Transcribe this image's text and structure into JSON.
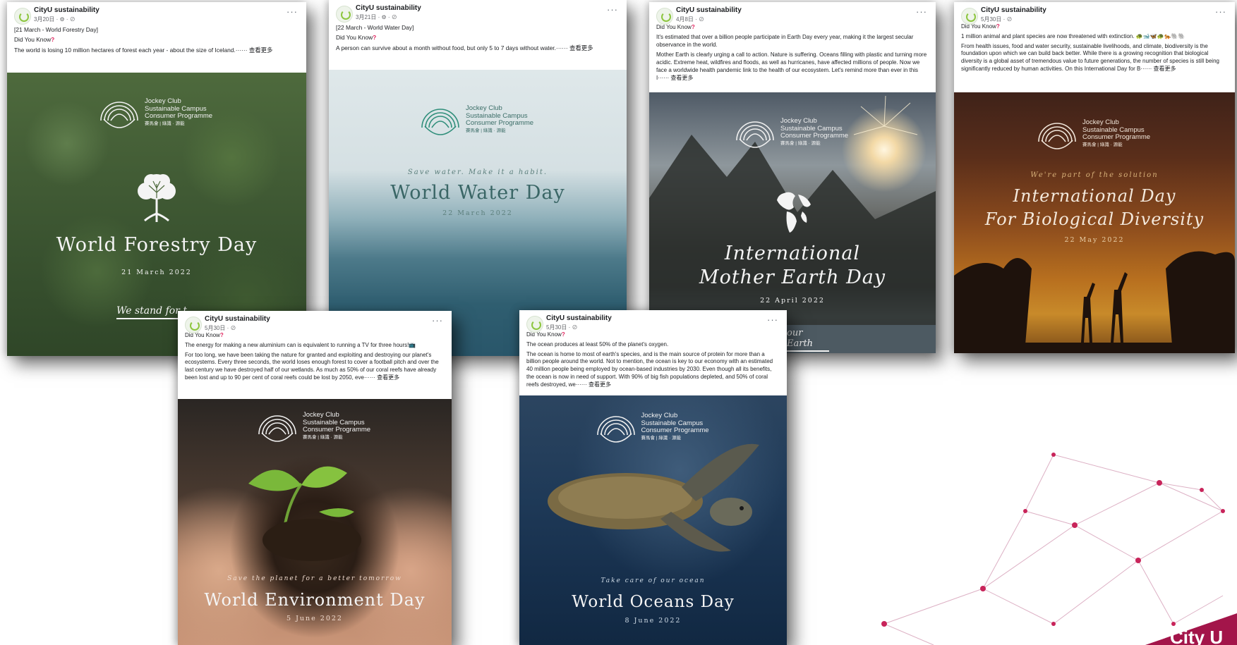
{
  "posts": [
    {
      "page_name": "CityU sustainability",
      "date": "3月20日 · ⚙ · ⊘",
      "lines": [
        "[21 March - World Forestry Day]"
      ],
      "did_you_know": "Did You Know",
      "body": "The world is losing 10 million hectares of forest each year - about the size of Iceland.······ 查看更多",
      "logo": {
        "line1": "Jockey Club",
        "line2": "Sustainable Campus",
        "line3": "Consumer Programme",
        "line4": "賽馬會 | 綠識 · 源能"
      },
      "title": "World Forestry Day",
      "date_line": "21 March 2022",
      "tagline": "We stand for t"
    },
    {
      "page_name": "CityU sustainability",
      "date": "3月21日 · ⚙ · ⊘",
      "lines": [
        "[22 March - World Water Day]"
      ],
      "did_you_know": "Did You Know",
      "body": "A person can survive about a month without food, but only 5 to 7 days without water.······ 查看更多",
      "logo": {
        "line1": "Jockey Club",
        "line2": "Sustainable Campus",
        "line3": "Consumer Programme",
        "line4": "賽馬會 | 綠識 · 源能"
      },
      "title": "World Water Day",
      "date_line": "22 March 2022",
      "tagline": "Save water. Make it a habit."
    },
    {
      "page_name": "CityU sustainability",
      "date": "4月8日 · ⊘",
      "lines": [],
      "did_you_know": "Did You Know",
      "body": "It's estimated that over a billion people participate in Earth Day every year, making it the largest secular observance in the world.",
      "body2": "Mother Earth is clearly urging a call to action. Nature is suffering. Oceans filling with plastic and turning more acidic. Extreme heat, wildfires and floods, as well as hurricanes, have affected millions of people. Now we face a worldwide health pandemic link to the health of our ecosystem. Let's remind more than ever in this I······ 查看更多",
      "logo": {
        "line1": "Jockey Club",
        "line2": "Sustainable Campus",
        "line3": "Consumer Programme",
        "line4": "賽馬會 | 綠識 · 源能"
      },
      "title_l1": "International",
      "title_l2": "Mother Earth Day",
      "date_line": "22 April 2022",
      "tagline": "our Earth"
    },
    {
      "page_name": "CityU sustainability",
      "date": "5月30日 · ⊘",
      "lines": [],
      "did_you_know": "Did You Know",
      "body": "1 million animal and plant species are now threatened with extinction. 🐢🐋🦋🐢🐅🐘🐘",
      "body2": "From health issues, food and water security, sustainable livelihoods, and climate, biodiversity is the foundation upon which we can build back better. While there is a growing recognition that biological diversity is a global asset of tremendous value to future generations, the number of species is still being significantly reduced by human activities. On this International Day for B······ 查看更多",
      "logo": {
        "line1": "Jockey Club",
        "line2": "Sustainable Campus",
        "line3": "Consumer Programme",
        "line4": "賽馬會 | 綠識 · 源能"
      },
      "title_l1": "International Day",
      "title_l2": "For Biological Diversity",
      "date_line": "22 May 2022",
      "tagline": "We're part of the solution"
    },
    {
      "page_name": "CityU sustainability",
      "date": "5月30日 · ⊘",
      "lines": [],
      "did_you_know": "Did You Know",
      "body": "The energy for making a new aluminium can is equivalent to running a TV for three hours!📺",
      "body2": "For too long, we have been taking the nature for granted and exploiting and destroying our planet's ecosystems. Every three seconds, the world loses enough forest to cover a football pitch and over the last century we have destroyed half of our wetlands. As much as 50% of our coral reefs have already been lost and up to 90 per cent of coral reefs could be lost by 2050, eve······ 查看更多",
      "logo": {
        "line1": "Jockey Club",
        "line2": "Sustainable Campus",
        "line3": "Consumer Programme",
        "line4": "賽馬會 | 綠識 · 源能"
      },
      "title": "World Environment Day",
      "date_line": "5 June 2022",
      "tagline": "Save the planet for a better tomorrow"
    },
    {
      "page_name": "CityU sustainability",
      "date": "5月30日 · ⊘",
      "lines": [],
      "did_you_know": "Did You Know",
      "body": "The ocean produces at least 50% of the planet's oxygen.",
      "body2": "The ocean is home to most of earth's species, and is the main source of protein for more than a billion people around the world. Not to mention, the ocean is key to our economy with an estimated 40 million people being employed by ocean-based industries by 2030. Even though all its benefits, the ocean is now in need of support. With 90% of big fish populations depleted, and 50% of coral reefs destroyed, we······ 查看更多",
      "logo": {
        "line1": "Jockey Club",
        "line2": "Sustainable Campus",
        "line3": "Consumer Programme",
        "line4": "賽馬會 | 綠識 · 源能"
      },
      "title": "World Oceans Day",
      "date_line": "8 June 2022",
      "tagline": "Take care of our ocean"
    }
  ],
  "more_icon": "···",
  "brand_corner": "City U",
  "colors": {
    "accent_pink": "#c8245a",
    "water_teal": "#2f8e7a"
  }
}
